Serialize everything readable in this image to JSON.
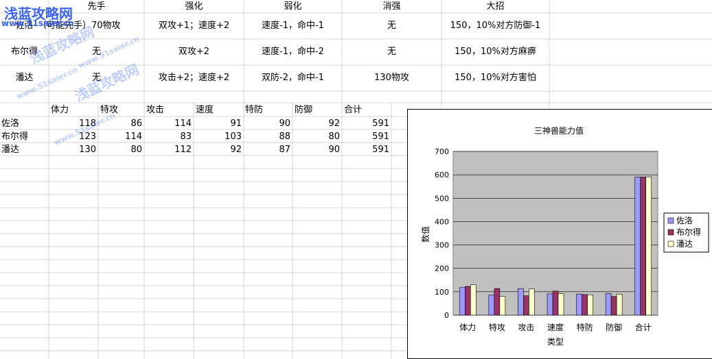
{
  "watermarks": {
    "logo": "浅蓝攻略网",
    "url": "www.51saier.cn"
  },
  "table1": {
    "headers": [
      "先手",
      "强化",
      "弱化",
      "消强",
      "大招"
    ],
    "rows": [
      {
        "name": "佐洛",
        "xianshou": "（可能先手）70物攻",
        "qianghua": "双攻+1；速度+2",
        "ruohua": "速度-1，命中-1",
        "xiaoqiang": "无",
        "dazhao": "150，10%对方防御-1"
      },
      {
        "name": "布尔得",
        "xianshou": "无",
        "qianghua": "双攻+2",
        "ruohua": "速度-1，命中-2",
        "xiaoqiang": "无",
        "dazhao": "150，10%对方麻痹"
      },
      {
        "name": "潘达",
        "xianshou": "无",
        "qianghua": "攻击+2；速度+2",
        "ruohua": "双防-2，命中-1",
        "xiaoqiang": "130物攻",
        "dazhao": "150，10%对方害怕"
      }
    ]
  },
  "table2": {
    "headers": [
      "体力",
      "特攻",
      "攻击",
      "速度",
      "特防",
      "防御",
      "合计"
    ],
    "rows": [
      {
        "name": "佐洛",
        "values": [
          "118",
          "86",
          "114",
          "91",
          "90",
          "92",
          "591"
        ]
      },
      {
        "name": "布尔得",
        "values": [
          "123",
          "114",
          "83",
          "103",
          "88",
          "80",
          "591"
        ]
      },
      {
        "name": "潘达",
        "values": [
          "130",
          "80",
          "112",
          "92",
          "87",
          "90",
          "591"
        ]
      }
    ]
  },
  "chart_data": {
    "type": "bar",
    "title": "三神兽能力值",
    "xlabel": "类型",
    "ylabel": "数值",
    "ylim": [
      0,
      700
    ],
    "yticks": [
      "0",
      "100",
      "200",
      "300",
      "400",
      "500",
      "600",
      "700"
    ],
    "categories": [
      "体力",
      "特攻",
      "攻击",
      "速度",
      "特防",
      "防御",
      "合计"
    ],
    "series": [
      {
        "name": "佐洛",
        "values": [
          118,
          86,
          114,
          91,
          90,
          92,
          591
        ],
        "color": "#9999ff"
      },
      {
        "name": "布尔得",
        "values": [
          123,
          114,
          83,
          103,
          88,
          80,
          591
        ],
        "color": "#993366"
      },
      {
        "name": "潘达",
        "values": [
          130,
          80,
          112,
          92,
          87,
          90,
          591
        ],
        "color": "#ffffcc"
      }
    ],
    "plot_bg": "#c0c0c0",
    "legend": "right"
  }
}
